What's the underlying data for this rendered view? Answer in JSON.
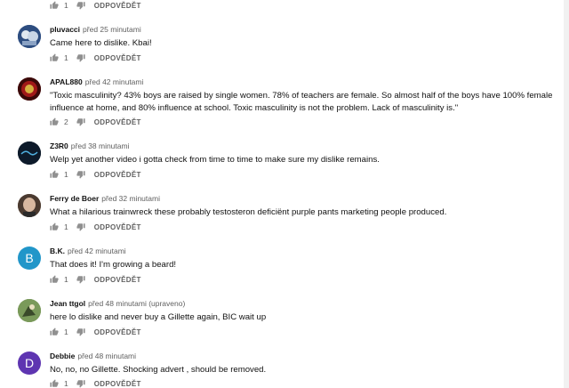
{
  "top_actions": {
    "likes": "1",
    "reply_label": "ODPOVĚDĚT"
  },
  "comments": [
    {
      "author": "pluvacci",
      "time": "před 25 minutami",
      "text": "Came here to dislike. Kbai!",
      "likes": "1",
      "reply_label": "ODPOVĚDĚT",
      "avatar_color": "#3b5a8f"
    },
    {
      "author": "APAL880",
      "time": "před 42 minutami",
      "text": "\"Toxic masculinity?  43% boys are raised by single women. 78% of teachers are female. So almost half of the boys have 100% female influence at home, and 80% influence at school.  Toxic masculinity is not the problem. Lack of masculinity is.\"",
      "likes": "2",
      "reply_label": "ODPOVĚDĚT",
      "avatar_color": "#6b1010"
    },
    {
      "author": "Z3R0",
      "time": "před 38 minutami",
      "text": "Welp yet another video i gotta check from time to time to make sure my dislike remains.",
      "likes": "1",
      "reply_label": "ODPOVĚDĚT",
      "avatar_color": "#0d1a2a"
    },
    {
      "author": "Ferry de Boer",
      "time": "před 32 minutami",
      "text": "What a hilarious trainwreck these probably testosteron deficiënt purple pants marketing people produced.",
      "likes": "1",
      "reply_label": "ODPOVĚDĚT",
      "avatar_color": "#8a6a55"
    },
    {
      "author": "B.K.",
      "time": "před 42 minutami",
      "text": "That does it! I'm growing a beard!",
      "likes": "1",
      "reply_label": "ODPOVĚDĚT",
      "avatar_letter": "B",
      "avatar_color": "#2196c9"
    },
    {
      "author": "Jean ttgol",
      "time": "před 48 minutami (upraveno)",
      "text": "here lo dislike and never buy a Gillette again, BIC wait up",
      "likes": "1",
      "reply_label": "ODPOVĚDĚT",
      "avatar_color": "#5a7a3a"
    },
    {
      "author": "Debbie",
      "time": "před 48 minutami",
      "text": "No, no, no Gillette. Shocking advert , should be removed.",
      "likes": "1",
      "reply_label": "ODPOVĚDĚT",
      "avatar_letter": "D",
      "avatar_color": "#5e35b1"
    }
  ]
}
